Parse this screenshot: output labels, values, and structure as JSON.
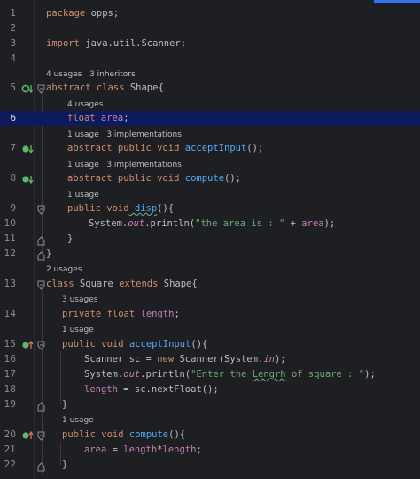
{
  "editor": {
    "line_numbers": [
      "1",
      "2",
      "3",
      "4",
      "5",
      "6",
      "7",
      "8",
      "9",
      "10",
      "11",
      "12",
      "13",
      "14",
      "15",
      "16",
      "17",
      "18",
      "19",
      "20",
      "21",
      "22"
    ],
    "hints": {
      "shape_usages": "4 usages",
      "shape_inheritors": "3 inheritors",
      "area_usages": "4 usages",
      "accept_usage": "1 usage",
      "accept_impls": "3 implementations",
      "compute_usage": "1 usage",
      "compute_impls": "3 implementations",
      "disp_usage": "1 usage",
      "square_usages": "2 usages",
      "length_usages": "3 usages",
      "square_accept_usage": "1 usage",
      "square_compute_usage": "1 usage"
    },
    "code": {
      "l1_kw": "package",
      "l1_rest": " opps;",
      "l3_kw": "import",
      "l3_rest": " java.util.Scanner;",
      "l5_kw": "abstract class",
      "l5_rest": " Shape{",
      "l6_kw": "float",
      "l6_field": " area",
      "l6_rest": ";",
      "l7_kw": "abstract public void",
      "l7_fn": " acceptInput",
      "l7_rest": "();",
      "l8_kw": "abstract public void",
      "l8_fn": " compute",
      "l8_rest": "();",
      "l9_kw": "public void",
      "l9_fn": " disp",
      "l9_rest": "(){",
      "l10_a": "System.",
      "l10_out": "out",
      "l10_b": ".println(",
      "l10_str": "\"the area is : \"",
      "l10_c": " + ",
      "l10_field": "area",
      "l10_d": ");",
      "l11": "}",
      "l12": "}",
      "l13_kw": "class",
      "l13_a": " Square ",
      "l13_kw2": "extends",
      "l13_b": " Shape{",
      "l14_kw": "private float",
      "l14_field": " length",
      "l14_rest": ";",
      "l15_kw": "public void",
      "l15_fn": " acceptInput",
      "l15_rest": "(){",
      "l16_a": "Scanner sc = ",
      "l16_kw": "new",
      "l16_b": " Scanner(System.",
      "l16_in": "in",
      "l16_c": ");",
      "l17_a": "System.",
      "l17_out": "out",
      "l17_b": ".println(",
      "l17_str1": "\"Enter the ",
      "l17_typo": "Lengrh",
      "l17_str2": " of square : \"",
      "l17_c": ");",
      "l18_field": "length",
      "l18_rest": " = sc.nextFloat();",
      "l19": "}",
      "l20_kw": "public void",
      "l20_fn": " compute",
      "l20_rest": "(){",
      "l21_field1": "area",
      "l21_a": " = ",
      "l21_field2": "length",
      "l21_b": "*",
      "l21_field3": "length",
      "l21_c": ";",
      "l22": "}"
    },
    "colors": {
      "background": "#1e1f22",
      "keyword": "#cf8e6d",
      "function": "#56a8f5",
      "string": "#6aab73",
      "field": "#c77dbb",
      "selection": "#0d1b5e"
    }
  }
}
